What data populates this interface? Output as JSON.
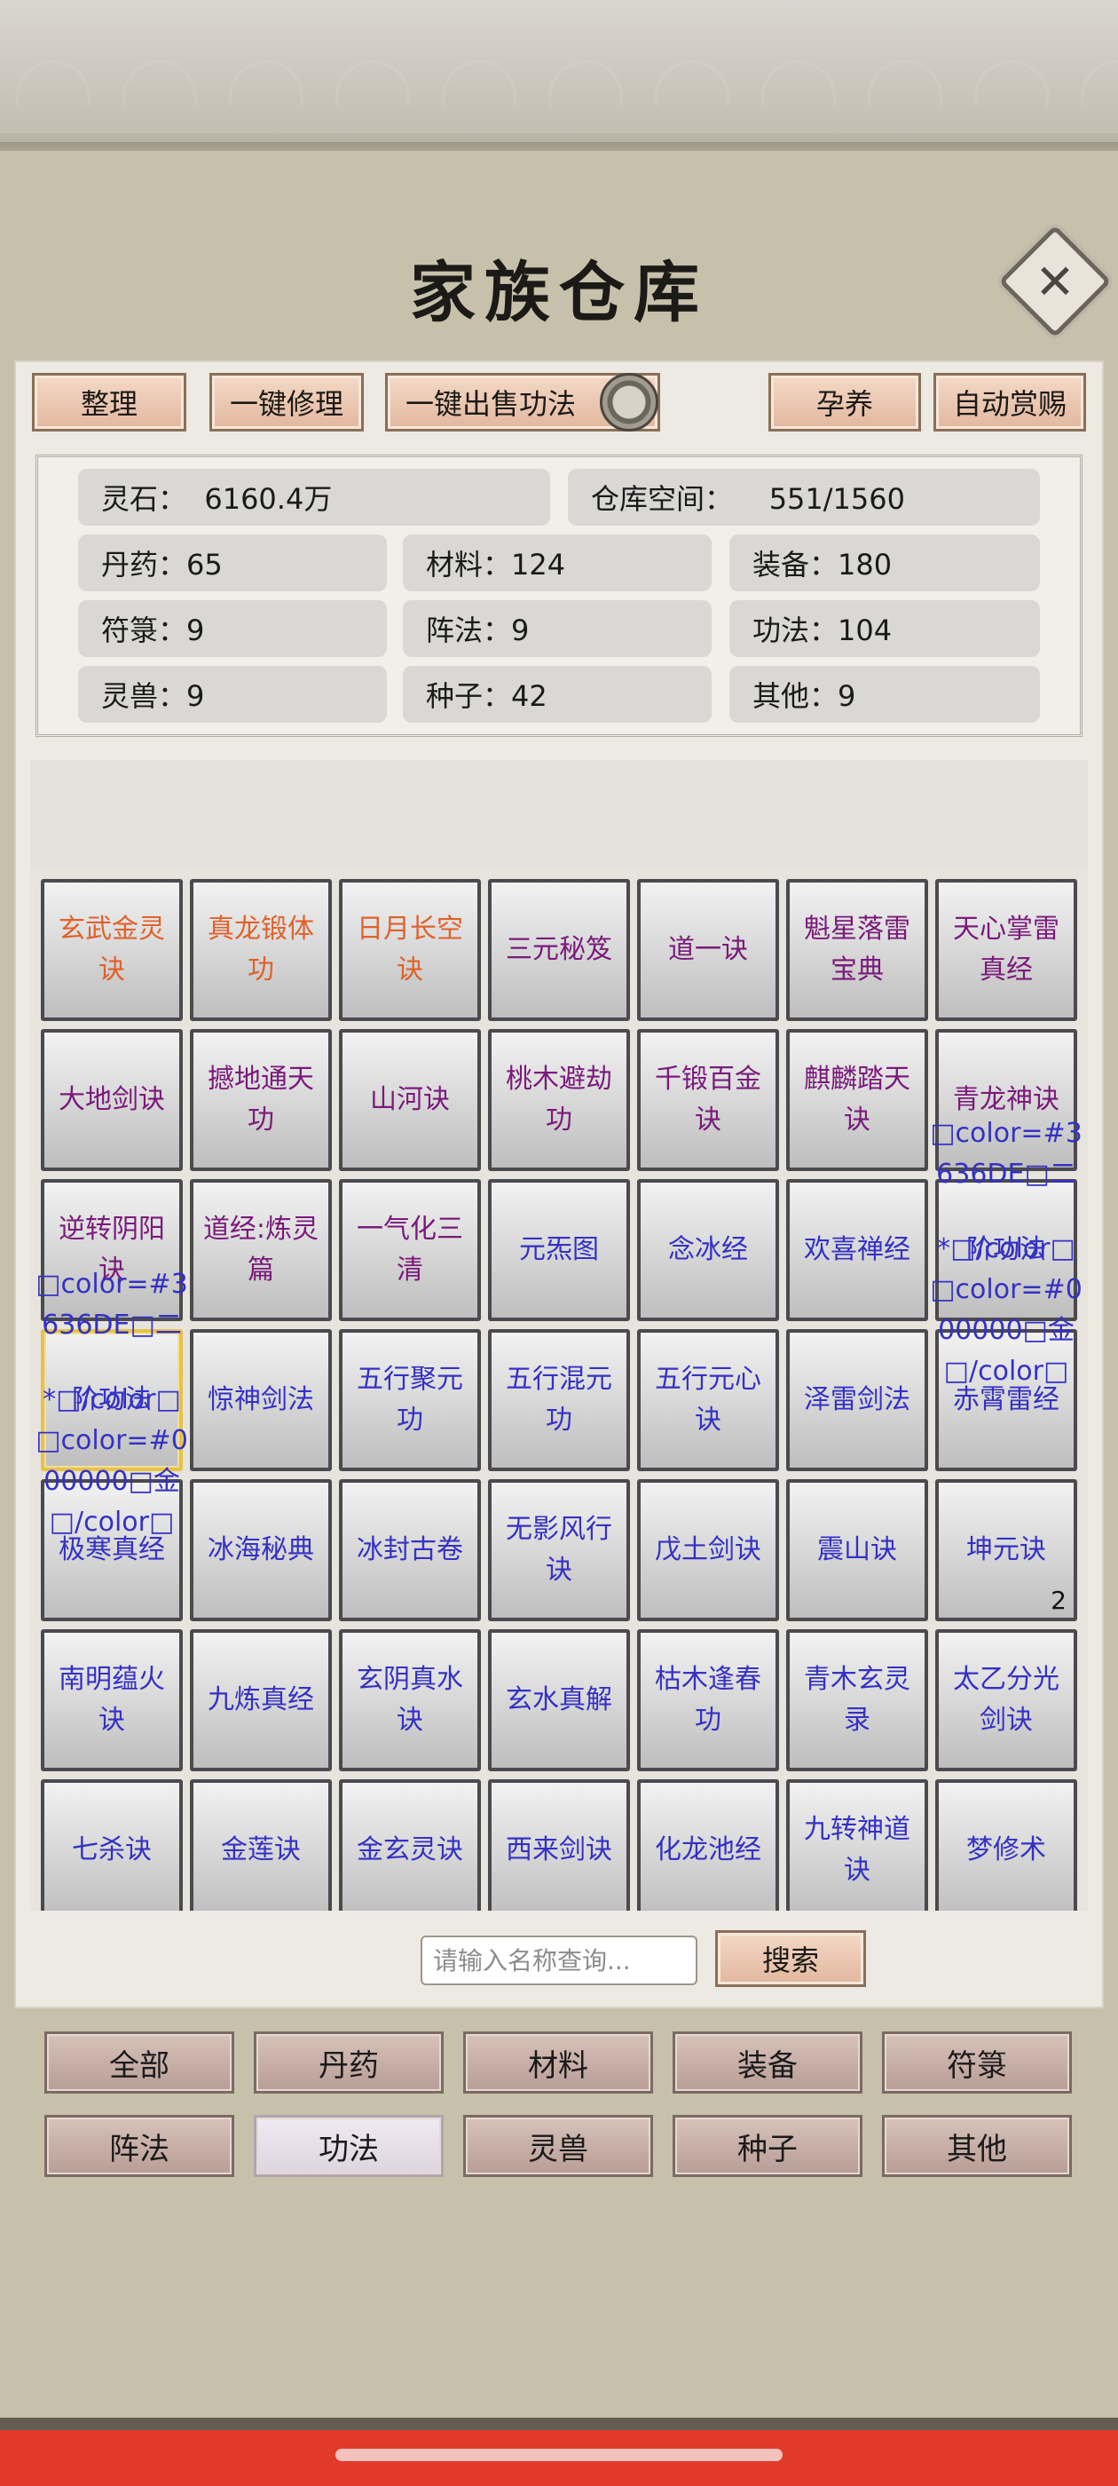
{
  "title": "家族仓库",
  "close_icon": "close-icon",
  "toolbar": {
    "arrange": "整理",
    "repair_all": "一键修理",
    "sell_all_skills": "一键出售功法",
    "nurture": "孕养",
    "auto_reward": "自动赏赐"
  },
  "stats": {
    "spirit_stone": "灵石：  6160.4万",
    "storage": "仓库空间：    551/1560",
    "pills": "丹药：65",
    "materials": "材料：124",
    "equipment": "装备：180",
    "talismans": "符箓：9",
    "formations": "阵法：9",
    "skills": "功法：104",
    "beasts": "灵兽：9",
    "seeds": "种子：42",
    "others": "其他：9"
  },
  "grid": {
    "items": [
      {
        "name": "玄武金灵诀",
        "color": "#e0612a"
      },
      {
        "name": "真龙锻体功",
        "color": "#e0612a"
      },
      {
        "name": "日月长空诀",
        "color": "#e0612a"
      },
      {
        "name": "三元秘笈",
        "color": "#7a1a7a"
      },
      {
        "name": "道一诀",
        "color": "#7a1a7a"
      },
      {
        "name": "魁星落雷宝典",
        "color": "#7a1a7a"
      },
      {
        "name": "天心掌雷真经",
        "color": "#7a1a7a"
      },
      {
        "name": "大地剑诀",
        "color": "#7a1a7a"
      },
      {
        "name": "撼地通天功",
        "color": "#7a1a7a"
      },
      {
        "name": "山河诀",
        "color": "#7a1a7a"
      },
      {
        "name": "桃木避劫功",
        "color": "#7a1a7a"
      },
      {
        "name": "千锻百金诀",
        "color": "#7a1a7a"
      },
      {
        "name": "麒麟踏天诀",
        "color": "#7a1a7a"
      },
      {
        "name": "青龙神诀",
        "color": "#7a1a7a"
      },
      {
        "name": "逆转阴阳诀",
        "color": "#7a1a7a"
      },
      {
        "name": "道经:炼灵篇",
        "color": "#7a1a7a"
      },
      {
        "name": "一气化三清",
        "color": "#7a1a7a"
      },
      {
        "name": "元炁图",
        "color": "#3431c4"
      },
      {
        "name": "念冰经",
        "color": "#3431c4"
      },
      {
        "name": "欢喜禅经",
        "color": "#3431c4"
      },
      {
        "name": "阶功法",
        "color": "#3431c4"
      },
      {
        "name": "阶功法",
        "color": "#3431c4"
      },
      {
        "name": "惊神剑法",
        "color": "#3431c4"
      },
      {
        "name": "五行聚元功",
        "color": "#3431c4"
      },
      {
        "name": "五行混元功",
        "color": "#3431c4"
      },
      {
        "name": "五行元心诀",
        "color": "#3431c4"
      },
      {
        "name": "泽雷剑法",
        "color": "#3431c4"
      },
      {
        "name": "赤霄雷经",
        "color": "#3431c4"
      },
      {
        "name": "极寒真经",
        "color": "#3431c4"
      },
      {
        "name": "冰海秘典",
        "color": "#3431c4"
      },
      {
        "name": "冰封古卷",
        "color": "#3431c4"
      },
      {
        "name": "无影风行诀",
        "color": "#3431c4"
      },
      {
        "name": "戊土剑诀",
        "color": "#3431c4"
      },
      {
        "name": "震山诀",
        "color": "#3431c4"
      },
      {
        "name": "坤元诀",
        "color": "#3431c4",
        "qty": "2"
      },
      {
        "name": "南明蕴火诀",
        "color": "#3431c4"
      },
      {
        "name": "九炼真经",
        "color": "#3431c4"
      },
      {
        "name": "玄阴真水诀",
        "color": "#3431c4"
      },
      {
        "name": "玄水真解",
        "color": "#3431c4"
      },
      {
        "name": "枯木逢春功",
        "color": "#3431c4"
      },
      {
        "name": "青木玄灵录",
        "color": "#3431c4"
      },
      {
        "name": "太乙分光剑诀",
        "color": "#3431c4"
      },
      {
        "name": "七杀诀",
        "color": "#3431c4"
      },
      {
        "name": "金莲诀",
        "color": "#3431c4"
      },
      {
        "name": "金玄灵诀",
        "color": "#3431c4"
      },
      {
        "name": "西来剑诀",
        "color": "#3431c4"
      },
      {
        "name": "化龙池经",
        "color": "#3431c4"
      },
      {
        "name": "九转神道诀",
        "color": "#3431c4"
      },
      {
        "name": "梦修术",
        "color": "#3431c4"
      }
    ],
    "overflow_text": {
      "r2c7": "□color=#3\n636DE□二",
      "r3c1": "□color=#3\n636DE□二",
      "r3c7": "*□/color□\n□color=#0\n00000□金\n□/color□",
      "r4c1": "*□/color□\n□color=#0\n00000□金\n□/color□"
    }
  },
  "search": {
    "placeholder": "请输入名称查询...",
    "button": "搜索"
  },
  "categories": [
    "全部",
    "丹药",
    "材料",
    "装备",
    "符箓",
    "阵法",
    "功法",
    "灵兽",
    "种子",
    "其他"
  ],
  "active_category": "功法"
}
